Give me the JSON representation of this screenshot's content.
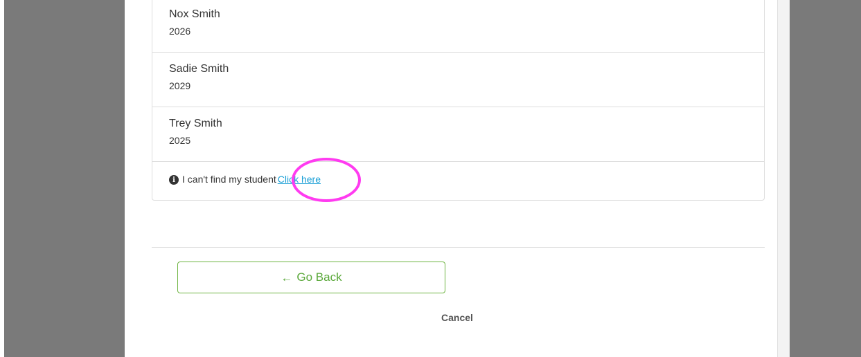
{
  "students": [
    {
      "name": "Nox Smith",
      "year": "2026"
    },
    {
      "name": "Sadie Smith",
      "year": "2029"
    },
    {
      "name": "Trey Smith",
      "year": "2025"
    }
  ],
  "not_found": {
    "icon": "info-icon",
    "text": "I can't find my student",
    "link_label": "Click here"
  },
  "actions": {
    "go_back_label": "Go Back",
    "go_back_icon": "arrow-left-icon",
    "cancel_label": "Cancel"
  },
  "colors": {
    "overlay": "#7a7a7a",
    "accent_green": "#6cb33f",
    "link_blue": "#1a9fd6",
    "highlight_ring": "#ff3bf0"
  }
}
